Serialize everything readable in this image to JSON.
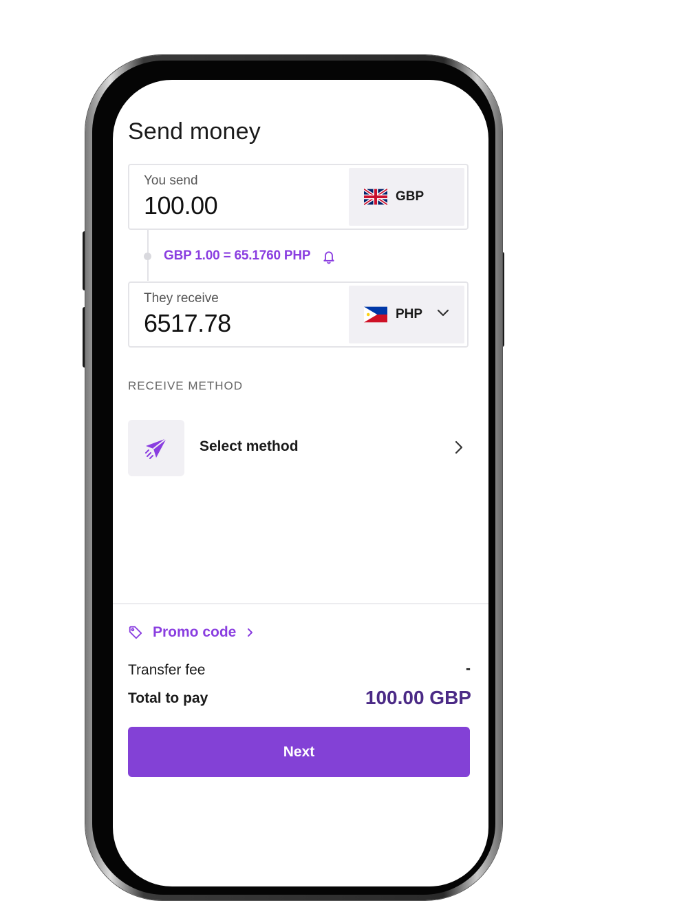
{
  "title": "Send money",
  "send": {
    "label": "You send",
    "amount": "100.00",
    "currency": "GBP",
    "flag_icon": "uk-flag-icon"
  },
  "rate": {
    "text": "GBP 1.00 = 65.1760 PHP",
    "icon": "bell-icon"
  },
  "receive": {
    "label": "They receive",
    "amount": "6517.78",
    "currency": "PHP",
    "flag_icon": "philippines-flag-icon"
  },
  "receive_method": {
    "section_label": "RECEIVE METHOD",
    "select_label": "Select method",
    "icon": "paper-plane-icon"
  },
  "promo": {
    "label": "Promo code",
    "icon": "tag-icon"
  },
  "summary": {
    "fee_label": "Transfer fee",
    "fee_value": "-",
    "total_label": "Total to pay",
    "total_value": "100.00 GBP"
  },
  "next_label": "Next",
  "colors": {
    "accent": "#8341d6",
    "accent_text": "#8a3ee0",
    "total_text": "#4b2a86",
    "card_bg": "#f1f0f4"
  }
}
